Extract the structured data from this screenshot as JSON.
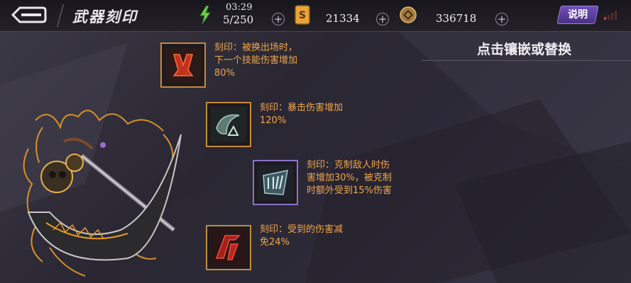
{
  "header": {
    "title": "武器刻印",
    "clock": "03:29",
    "stamina": "5/250",
    "tickets": "21334",
    "coins": "336718",
    "help_label": "说明",
    "plus": "+"
  },
  "panel": {
    "title": "点击镶嵌或替换"
  },
  "inscriptions": [
    {
      "text": "刻印：被换出场时，\n下一个技能伤害增加\n80%",
      "frame": "orange"
    },
    {
      "text": "刻印：暴击伤害增加\n120%",
      "frame": "orange"
    },
    {
      "text": "刻印：克制敌人时伤\n害增加30%，被克制\n时额外受到15%伤害",
      "frame": "purple"
    },
    {
      "text": "刻印：受到的伤害减\n免24%",
      "frame": "orange"
    }
  ],
  "colors": {
    "accent_orange": "#f0a64a",
    "frame_orange": "#c78a3a",
    "frame_purple": "#8872c8",
    "help_purple": "#5b3c9e"
  },
  "icons": [
    "back-arrow-icon",
    "lightning-icon",
    "ticket-icon",
    "coin-icon",
    "signal-icon"
  ]
}
